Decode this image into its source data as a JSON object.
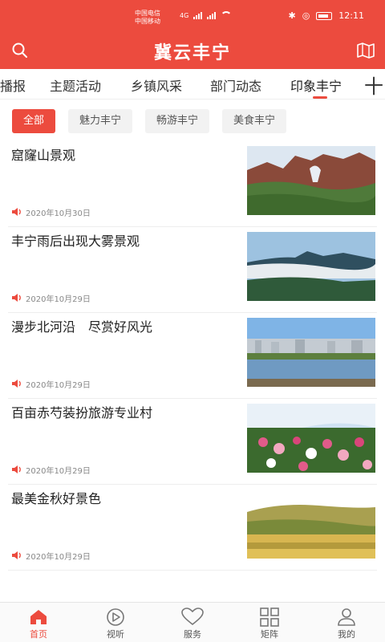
{
  "status_bar": {
    "carrier1": "中国电信",
    "carrier2": "中国移动",
    "signal_text": "4G",
    "time": "12:11"
  },
  "app": {
    "title": "冀云丰宁"
  },
  "tabs": [
    {
      "label": "播报"
    },
    {
      "label": "主题活动"
    },
    {
      "label": "乡镇风采"
    },
    {
      "label": "部门动态"
    },
    {
      "label": "印象丰宁",
      "active": true
    }
  ],
  "tabs_more": "十",
  "chips": [
    {
      "label": "全部",
      "active": true
    },
    {
      "label": "魅力丰宁"
    },
    {
      "label": "畅游丰宁"
    },
    {
      "label": "美食丰宁"
    }
  ],
  "news": [
    {
      "title": "窟窿山景观",
      "date": "2020年10月30日"
    },
    {
      "title": "丰宁雨后出现大雾景观",
      "date": "2020年10月29日"
    },
    {
      "title": "漫步北河沿　尽赏好风光",
      "date": "2020年10月29日"
    },
    {
      "title": "百亩赤芍装扮旅游专业村",
      "date": "2020年10月29日"
    },
    {
      "title": "最美金秋好景色",
      "date": "2020年10月29日"
    }
  ],
  "bottom_nav": [
    {
      "label": "首页",
      "active": true,
      "icon": "home-icon"
    },
    {
      "label": "视听",
      "icon": "play-icon"
    },
    {
      "label": "服务",
      "icon": "heart-icon"
    },
    {
      "label": "矩阵",
      "icon": "grid-icon"
    },
    {
      "label": "我的",
      "icon": "user-icon"
    }
  ],
  "colors": {
    "brand": "#ec4b3e"
  }
}
